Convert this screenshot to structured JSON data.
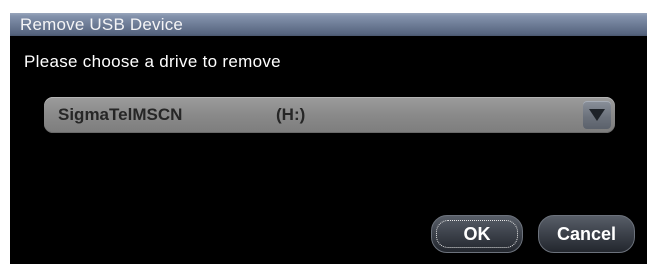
{
  "dialog": {
    "title": "Remove USB Device",
    "instruction": "Please choose a drive to remove",
    "drive_select": {
      "selected_name": "SigmaTelMSCN",
      "selected_letter": "(H:)",
      "arrow_icon": "triangle-down-icon"
    },
    "buttons": {
      "ok_label": "OK",
      "cancel_label": "Cancel"
    },
    "colors": {
      "background": "#000000",
      "title_bar": "#6f7d96",
      "combo": "#8f8f8f",
      "button": "#3c414a"
    }
  }
}
